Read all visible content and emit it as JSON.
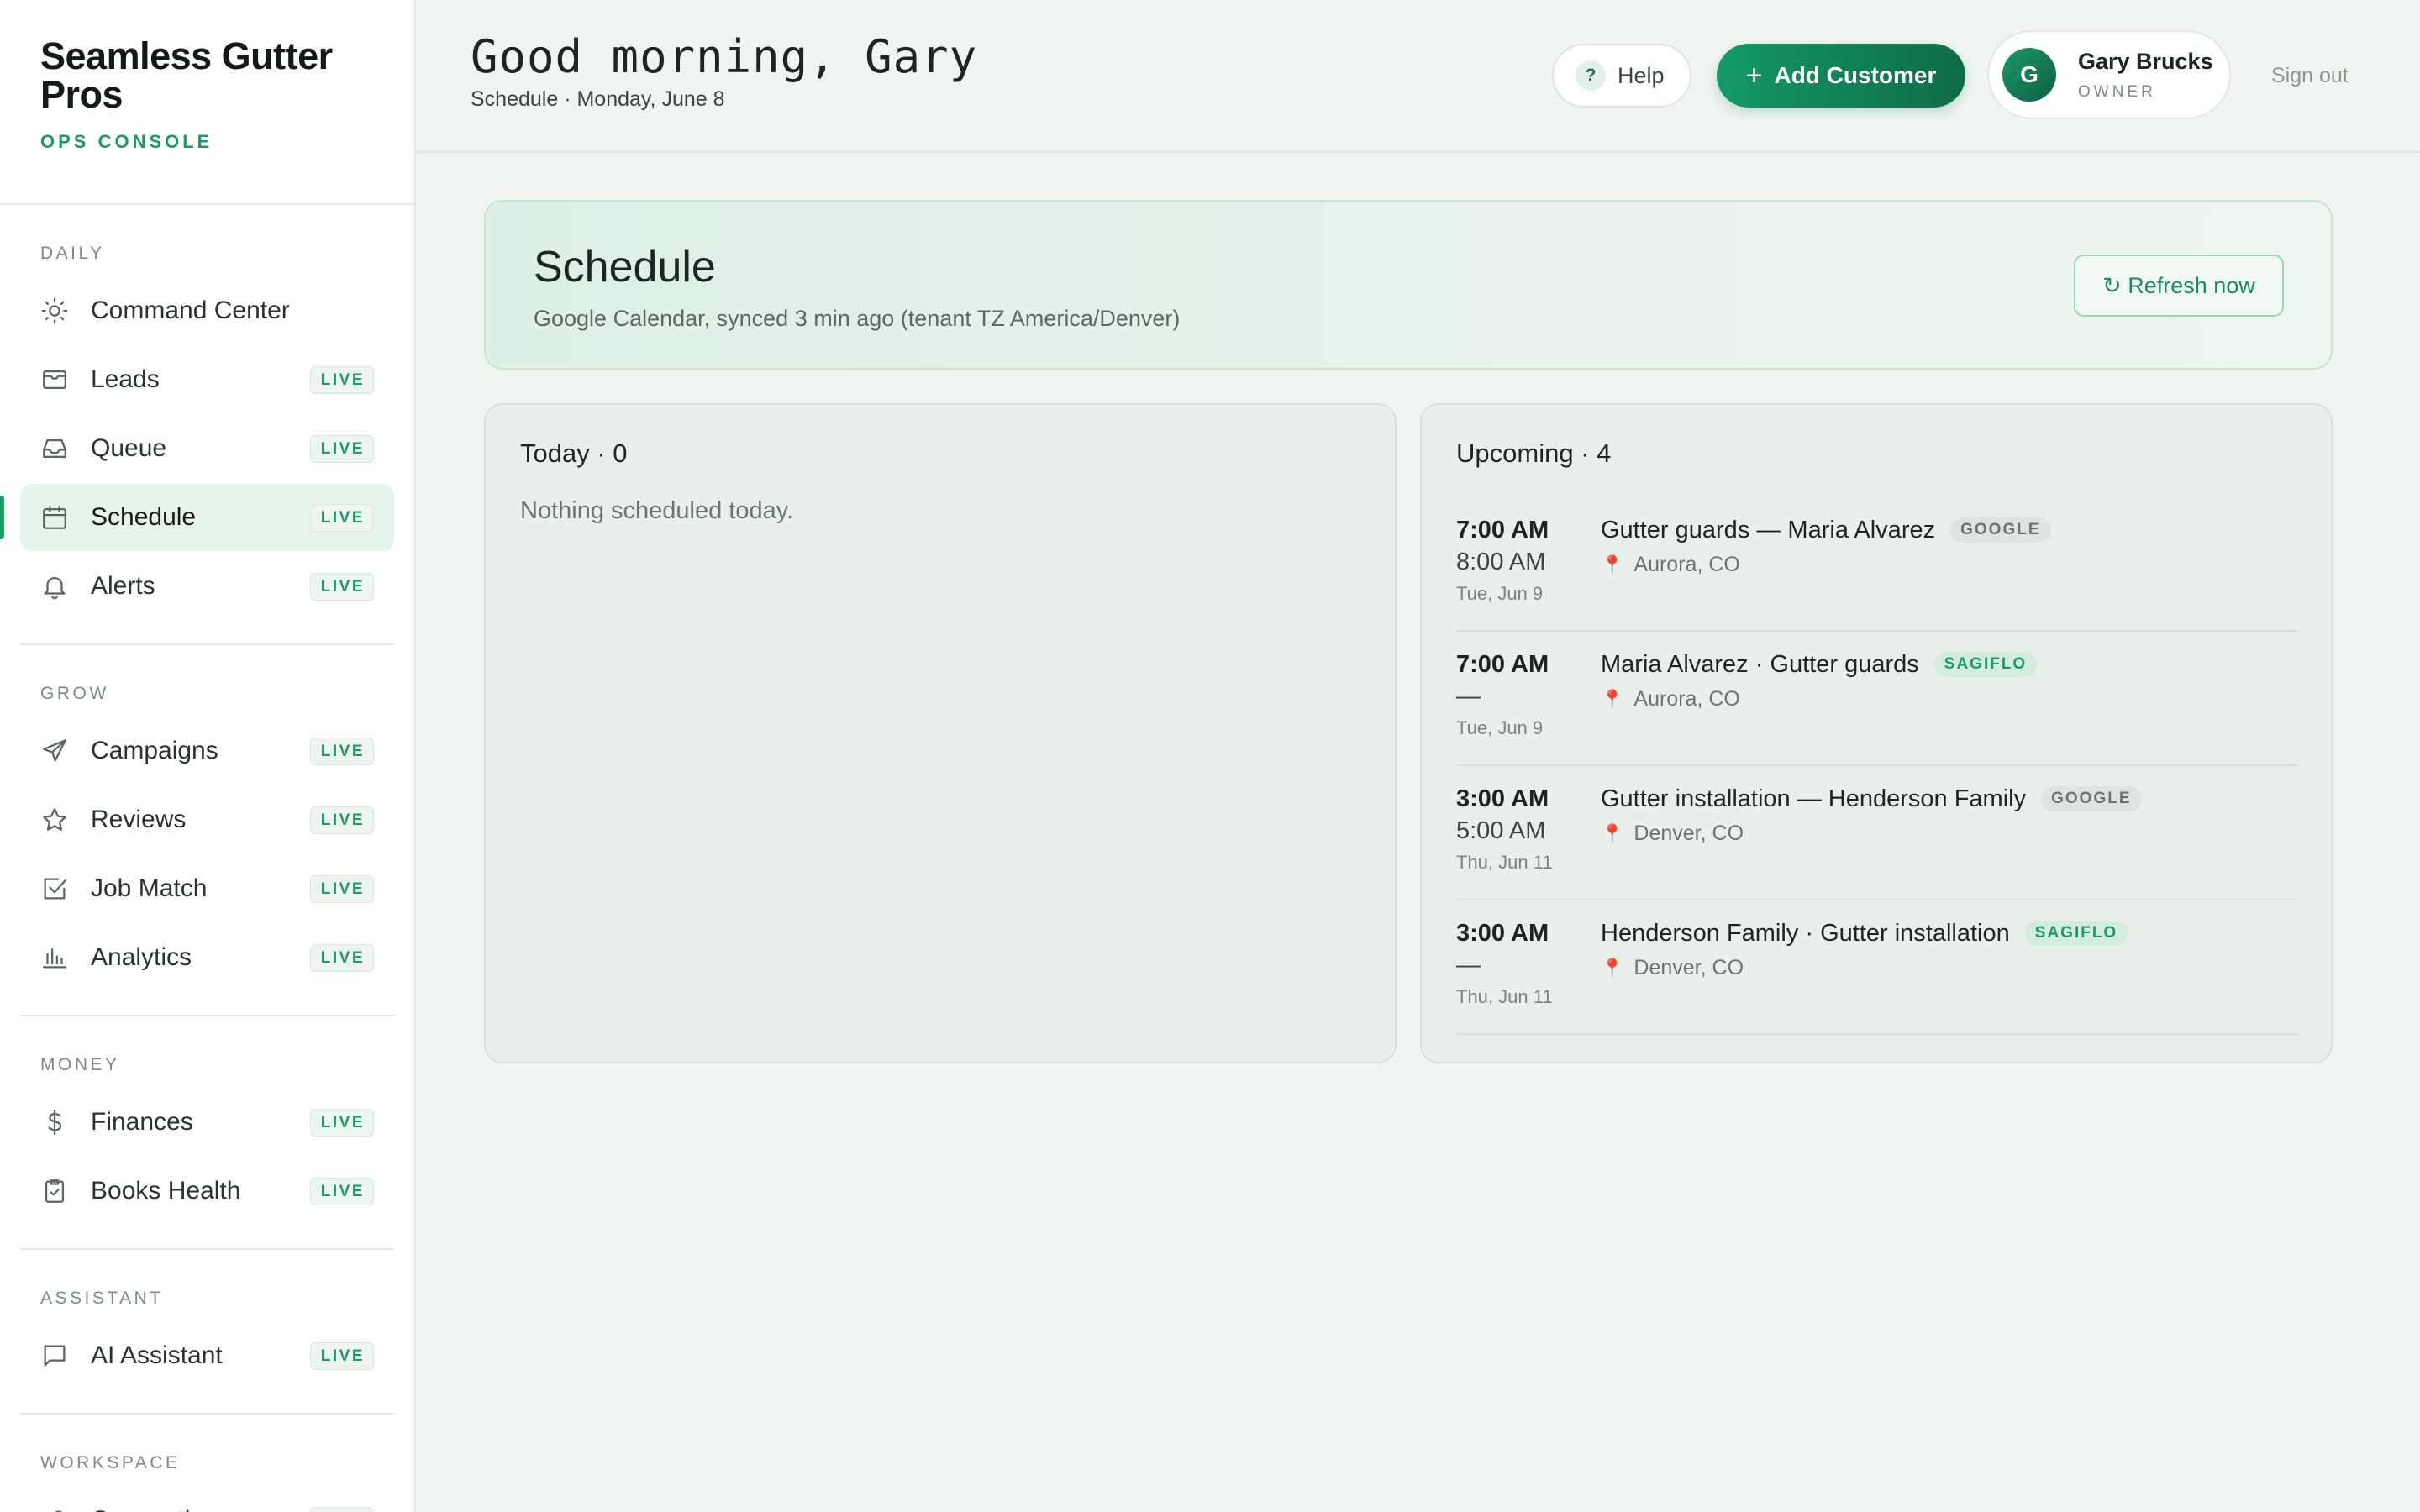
{
  "brand": {
    "name": "Seamless Gutter Pros",
    "subtitle": "OPS CONSOLE"
  },
  "nav": [
    {
      "section": "DAILY",
      "items": [
        {
          "label": "Command Center",
          "icon": "sun-icon",
          "badge": ""
        },
        {
          "label": "Leads",
          "icon": "mail-icon",
          "badge": "LIVE"
        },
        {
          "label": "Queue",
          "icon": "inbox-icon",
          "badge": "LIVE"
        },
        {
          "label": "Schedule",
          "icon": "calendar-icon",
          "badge": "LIVE",
          "active": true
        },
        {
          "label": "Alerts",
          "icon": "bell-icon",
          "badge": "LIVE"
        }
      ]
    },
    {
      "section": "GROW",
      "items": [
        {
          "label": "Campaigns",
          "icon": "send-icon",
          "badge": "LIVE"
        },
        {
          "label": "Reviews",
          "icon": "star-icon",
          "badge": "LIVE"
        },
        {
          "label": "Job Match",
          "icon": "check-square-icon",
          "badge": "LIVE"
        },
        {
          "label": "Analytics",
          "icon": "bar-chart-icon",
          "badge": "LIVE"
        }
      ]
    },
    {
      "section": "MONEY",
      "items": [
        {
          "label": "Finances",
          "icon": "dollar-icon",
          "badge": "LIVE"
        },
        {
          "label": "Books Health",
          "icon": "clipboard-check-icon",
          "badge": "LIVE"
        }
      ]
    },
    {
      "section": "ASSISTANT",
      "items": [
        {
          "label": "AI Assistant",
          "icon": "message-icon",
          "badge": "LIVE"
        }
      ]
    },
    {
      "section": "WORKSPACE",
      "items": [
        {
          "label": "Connections",
          "icon": "link-icon",
          "badge": "LIVE"
        }
      ]
    }
  ],
  "header": {
    "greeting": "Good morning, Gary",
    "subline": "Schedule · Monday, June 8",
    "help_label": "Help",
    "help_icon_glyph": "?",
    "add_label": "Add Customer",
    "add_icon_glyph": "+",
    "user": {
      "initial": "G",
      "name": "Gary Brucks",
      "role": "OWNER"
    },
    "signout_label": "Sign out"
  },
  "banner": {
    "title": "Schedule",
    "subtitle": "Google Calendar, synced 3 min ago (tenant TZ America/Denver)",
    "refresh_label": "↻ Refresh now"
  },
  "today": {
    "title": "Today · 0",
    "empty": "Nothing scheduled today."
  },
  "upcoming": {
    "title": "Upcoming · 4",
    "events": [
      {
        "start": "7:00 AM",
        "end": "8:00 AM",
        "date": "Tue, Jun 9",
        "title": "Gutter guards — Maria Alvarez",
        "source": "GOOGLE",
        "location": "Aurora, CO"
      },
      {
        "start": "7:00 AM",
        "end": "—",
        "date": "Tue, Jun 9",
        "title": "Maria Alvarez · Gutter guards",
        "source": "SAGIFLO",
        "location": "Aurora, CO"
      },
      {
        "start": "3:00 AM",
        "end": "5:00 AM",
        "date": "Thu, Jun 11",
        "title": "Gutter installation — Henderson Family",
        "source": "GOOGLE",
        "location": "Denver, CO"
      },
      {
        "start": "3:00 AM",
        "end": "—",
        "date": "Thu, Jun 11",
        "title": "Henderson Family · Gutter installation",
        "source": "SAGIFLO",
        "location": "Denver, CO"
      }
    ]
  },
  "colors": {
    "accent": "#1b9a66",
    "accent_dark": "#0e6b47",
    "background": "#f0f5f2",
    "pin": "#e2685e"
  }
}
